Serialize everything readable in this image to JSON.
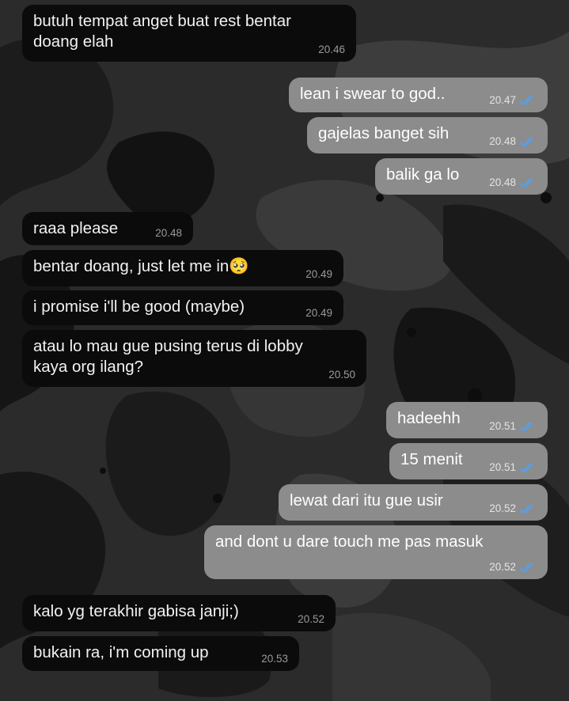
{
  "colors": {
    "incoming_bubble": "#0b0b0b",
    "outgoing_bubble": "#8c8c8c",
    "read_tick": "#4aa3ff"
  },
  "messages": [
    {
      "id": "m1",
      "dir": "in",
      "text": "butuh tempat anget buat rest bentar\ndoang elah",
      "time": "20.46"
    },
    {
      "id": "m2",
      "dir": "out",
      "text": "lean i swear to god..",
      "time": "20.47",
      "read": true
    },
    {
      "id": "m3",
      "dir": "out",
      "text": "gajelas banget sih",
      "time": "20.48",
      "read": true
    },
    {
      "id": "m4",
      "dir": "out",
      "text": "balik ga lo",
      "time": "20.48",
      "read": true
    },
    {
      "id": "m5",
      "dir": "in",
      "text": "raaa please",
      "time": "20.48"
    },
    {
      "id": "m6",
      "dir": "in",
      "text": "bentar doang, just let me in",
      "emoji": "🥺",
      "time": "20.49"
    },
    {
      "id": "m7",
      "dir": "in",
      "text": "i promise i'll be good (maybe)",
      "time": "20.49"
    },
    {
      "id": "m8",
      "dir": "in",
      "text": "atau lo mau gue pusing terus di lobby\nkaya org ilang?",
      "time": "20.50"
    },
    {
      "id": "m9",
      "dir": "out",
      "text": "hadeehh",
      "time": "20.51",
      "read": true
    },
    {
      "id": "m10",
      "dir": "out",
      "text": "15 menit",
      "time": "20.51",
      "read": true
    },
    {
      "id": "m11",
      "dir": "out",
      "text": "lewat dari itu gue usir",
      "time": "20.52",
      "read": true
    },
    {
      "id": "m12",
      "dir": "out",
      "text": "and dont u dare touch me pas masuk",
      "time": "20.52",
      "read": true
    },
    {
      "id": "m13",
      "dir": "in",
      "text": "kalo yg terakhir gabisa janji;)",
      "time": "20.52"
    },
    {
      "id": "m14",
      "dir": "in",
      "text": "bukain ra, i'm coming up",
      "time": "20.53"
    }
  ]
}
